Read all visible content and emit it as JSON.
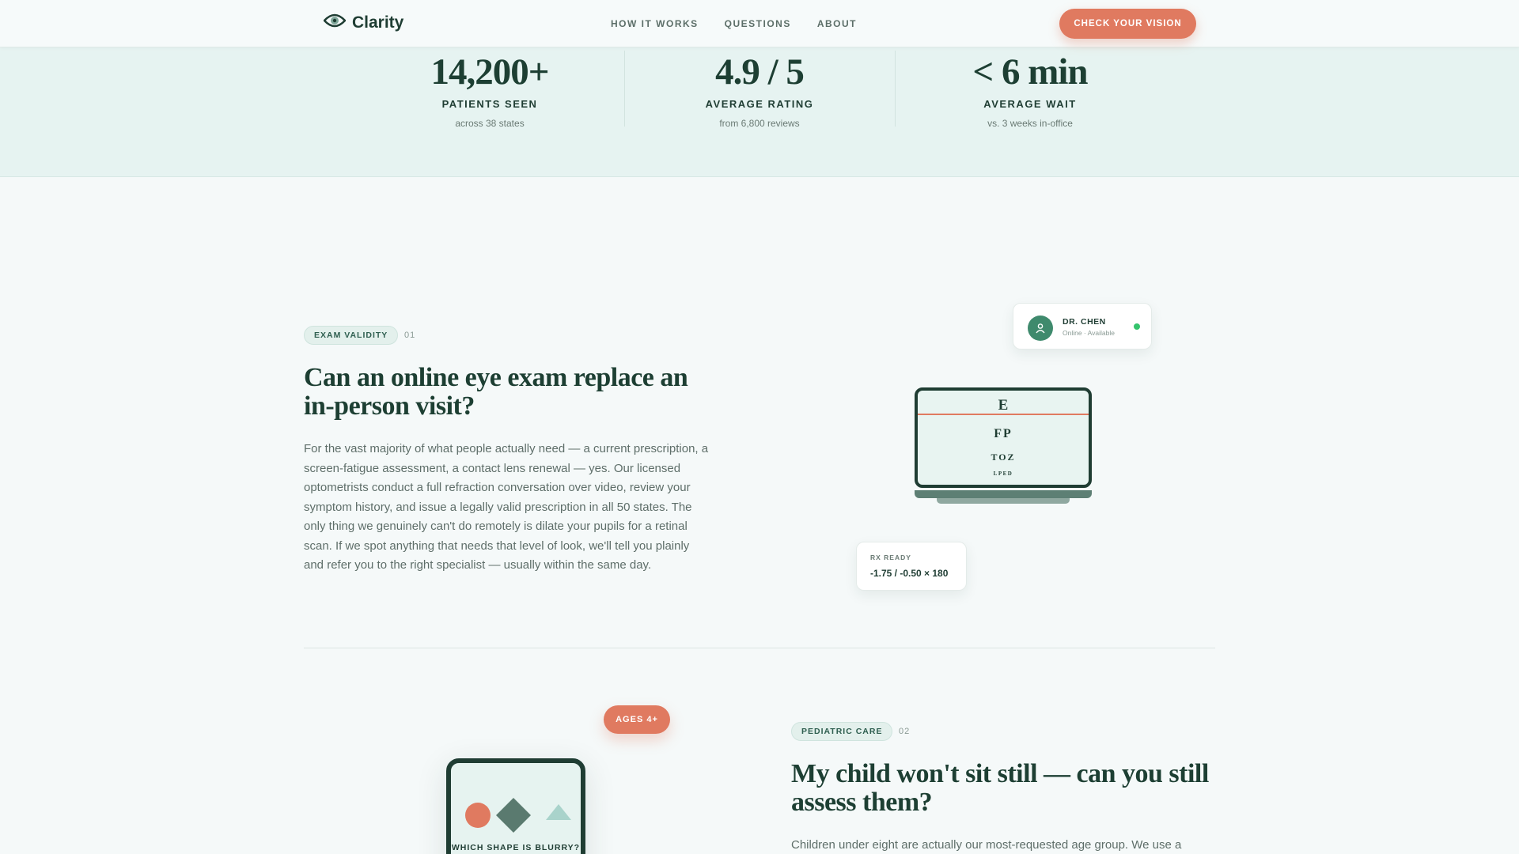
{
  "header": {
    "brand": "Clarity",
    "nav": [
      "HOW IT WORKS",
      "QUESTIONS",
      "ABOUT"
    ],
    "cta": "CHECK YOUR VISION"
  },
  "stats": [
    {
      "value": "14,200+",
      "label": "PATIENTS SEEN",
      "sub": "across 38 states"
    },
    {
      "value": "4.9 / 5",
      "label": "AVERAGE RATING",
      "sub": "from 6,800 reviews"
    },
    {
      "value": "< 6 min",
      "label": "AVERAGE WAIT",
      "sub": "vs. 3 weeks in-office"
    }
  ],
  "faq1": {
    "tag": "EXAM VALIDITY",
    "number": "01",
    "heading_line1": "Can an online eye exam replace an",
    "heading_line2": "in-person visit?",
    "body": "For the vast majority of what people actually need — a current prescription, a screen-fatigue assessment, a contact lens renewal — yes. Our licensed optometrists conduct a full refraction conversation over video, review your symptom history, and issue a legally valid prescription in all 50 states. The only thing we genuinely can't do remotely is dilate your pupils for a retinal scan. If we spot anything that needs that level of look, we'll tell you plainly and refer you to the right specialist — usually within the same day.",
    "eye_chart": [
      "E",
      "FP",
      "TOZ",
      "LPED"
    ],
    "doctor": {
      "name": "DR. CHEN",
      "status": "Online · Available"
    },
    "rx": {
      "label": "RX READY",
      "value": "-1.75 / -0.50 × 180"
    }
  },
  "faq2": {
    "tag": "PEDIATRIC CARE",
    "number": "02",
    "heading_line1": "My child won't sit still — can you still",
    "heading_line2": "assess them?",
    "body": "Children under eight are actually our most-requested age group. We use a",
    "ages_pill": "AGES 4+",
    "phone_question": "WHICH SHAPE IS BLURRY?"
  },
  "colors": {
    "accent": "#e07a60",
    "brand_dark": "#1f3d33",
    "stats_bg": "#e6f3f1",
    "online": "#35c46d"
  },
  "icons": [
    "eye-logo-icon",
    "user-icon"
  ]
}
